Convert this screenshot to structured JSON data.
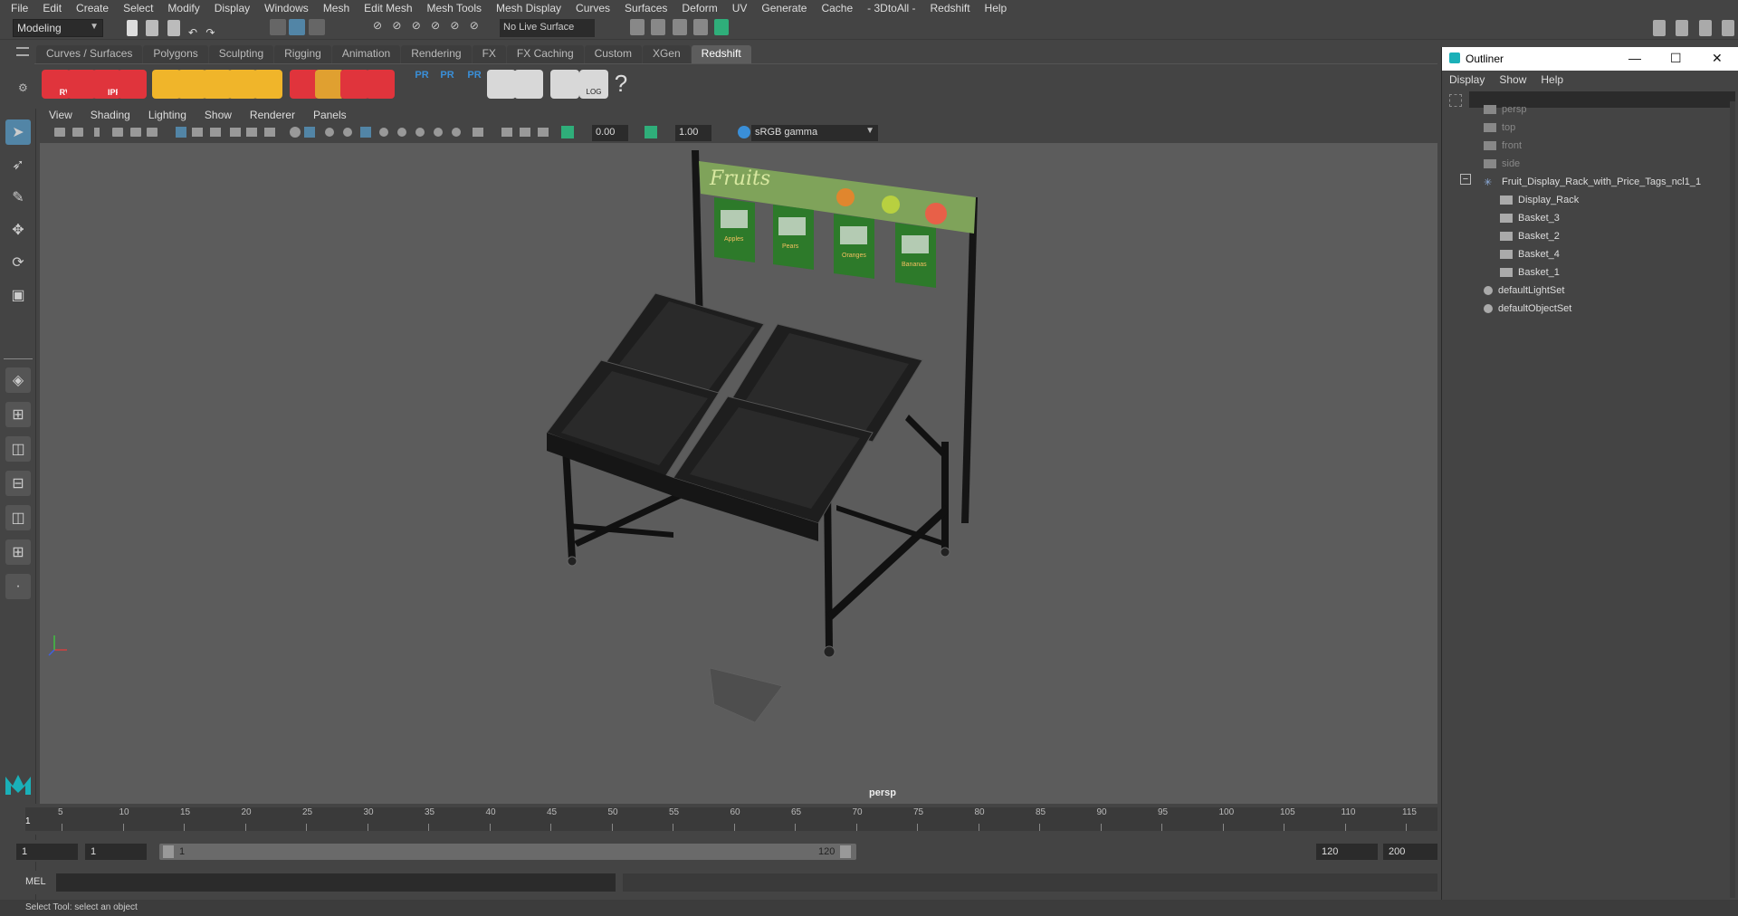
{
  "menubar": {
    "items": [
      "File",
      "Edit",
      "Create",
      "Select",
      "Modify",
      "Display",
      "Windows",
      "Mesh",
      "Edit Mesh",
      "Mesh Tools",
      "Mesh Display",
      "Curves",
      "Surfaces",
      "Deform",
      "UV",
      "Generate",
      "Cache",
      "- 3DtoAll -",
      "Redshift",
      "Help"
    ]
  },
  "statusline": {
    "mode": "Modeling",
    "live_surface": "No Live Surface"
  },
  "shelf": {
    "tabs": [
      "Curves / Surfaces",
      "Polygons",
      "Sculpting",
      "Rigging",
      "Animation",
      "Rendering",
      "FX",
      "FX Caching",
      "Custom",
      "XGen",
      "Redshift"
    ],
    "active_tab": "Redshift",
    "icons": [
      {
        "name": "rv-icon",
        "label": "RV",
        "color": "#e0343c"
      },
      {
        "name": "ipr-snapshot-icon",
        "label": "",
        "color": "#e0343c"
      },
      {
        "name": "ipr-icon",
        "label": "IPR",
        "color": "#e0343c"
      },
      {
        "name": "render-settings-icon",
        "label": "",
        "color": "#e0343c"
      },
      {
        "name": "light-plane-icon",
        "label": "",
        "color": "#f0b52a"
      },
      {
        "name": "portal-light-icon",
        "label": "",
        "color": "#f0b52a"
      },
      {
        "name": "spot-light-icon",
        "label": "",
        "color": "#f0b52a"
      },
      {
        "name": "dome-light-icon",
        "label": "",
        "color": "#f0b52a"
      },
      {
        "name": "sun-sky-icon",
        "label": "",
        "color": "#f0b52a"
      },
      {
        "name": "proxy-icon",
        "label": "",
        "color": "#e0343c"
      },
      {
        "name": "hair-icon",
        "label": "",
        "color": "#e0a030"
      },
      {
        "name": "volume-icon",
        "label": "",
        "color": "#e0343c"
      },
      {
        "name": "material-ball-icon",
        "label": "",
        "color": "#e0343c"
      },
      {
        "name": "pr-export-icon",
        "label": "PR",
        "color": "#3a8fd8"
      },
      {
        "name": "pr-import-icon",
        "label": "PR",
        "color": "#3a8fd8"
      },
      {
        "name": "pr-transfer-icon",
        "label": "PR",
        "color": "#3a8fd8"
      },
      {
        "name": "bowl-icon",
        "label": "",
        "color": "#dddddd"
      },
      {
        "name": "bowl-steam-icon",
        "label": "",
        "color": "#dddddd"
      },
      {
        "name": "script-editor-icon",
        "label": "",
        "color": "#dddddd"
      },
      {
        "name": "log-icon",
        "label": "LOG",
        "color": "#dddddd"
      },
      {
        "name": "help-icon",
        "label": "?",
        "color": "#dddddd"
      }
    ]
  },
  "viewport": {
    "menu": [
      "View",
      "Shading",
      "Lighting",
      "Show",
      "Renderer",
      "Panels"
    ],
    "exposure": "0.00",
    "gamma": "1.00",
    "color_space": "sRGB gamma",
    "camera": "persp",
    "sign_text": "Fruits",
    "tag_labels": [
      "Apples",
      "Pears",
      "Oranges",
      "Bananas"
    ]
  },
  "outliner": {
    "title": "Outliner",
    "menu": [
      "Display",
      "Show",
      "Help"
    ],
    "items": [
      {
        "label": "persp",
        "dim": true,
        "indent": 0,
        "icon": "camera-icon"
      },
      {
        "label": "top",
        "dim": true,
        "indent": 0,
        "icon": "camera-icon"
      },
      {
        "label": "front",
        "dim": true,
        "indent": 0,
        "icon": "camera-icon"
      },
      {
        "label": "side",
        "dim": true,
        "indent": 0,
        "icon": "camera-icon"
      },
      {
        "label": "Fruit_Display_Rack_with_Price_Tags_ncl1_1",
        "dim": false,
        "indent": 0,
        "icon": "group-icon"
      },
      {
        "label": "Display_Rack",
        "dim": false,
        "indent": 1,
        "icon": "mesh-icon"
      },
      {
        "label": "Basket_3",
        "dim": false,
        "indent": 1,
        "icon": "mesh-icon"
      },
      {
        "label": "Basket_2",
        "dim": false,
        "indent": 1,
        "icon": "mesh-icon"
      },
      {
        "label": "Basket_4",
        "dim": false,
        "indent": 1,
        "icon": "mesh-icon"
      },
      {
        "label": "Basket_1",
        "dim": false,
        "indent": 1,
        "icon": "mesh-icon"
      },
      {
        "label": "defaultLightSet",
        "dim": false,
        "indent": 0,
        "icon": "set-icon"
      },
      {
        "label": "defaultObjectSet",
        "dim": false,
        "indent": 0,
        "icon": "set-icon"
      }
    ]
  },
  "timeline": {
    "ticks": [
      "5",
      "10",
      "15",
      "20",
      "25",
      "30",
      "35",
      "40",
      "45",
      "50",
      "55",
      "60",
      "65",
      "70",
      "75",
      "80",
      "85",
      "90",
      "95",
      "100",
      "105",
      "110",
      "115"
    ],
    "current_frame": "1"
  },
  "range": {
    "start": "1",
    "playback_start": "1",
    "slider_start": "1",
    "slider_end": "120",
    "playback_end": "120",
    "end": "200"
  },
  "cmdline": {
    "lang": "MEL"
  },
  "helpline": {
    "text": "Select Tool: select an object"
  }
}
